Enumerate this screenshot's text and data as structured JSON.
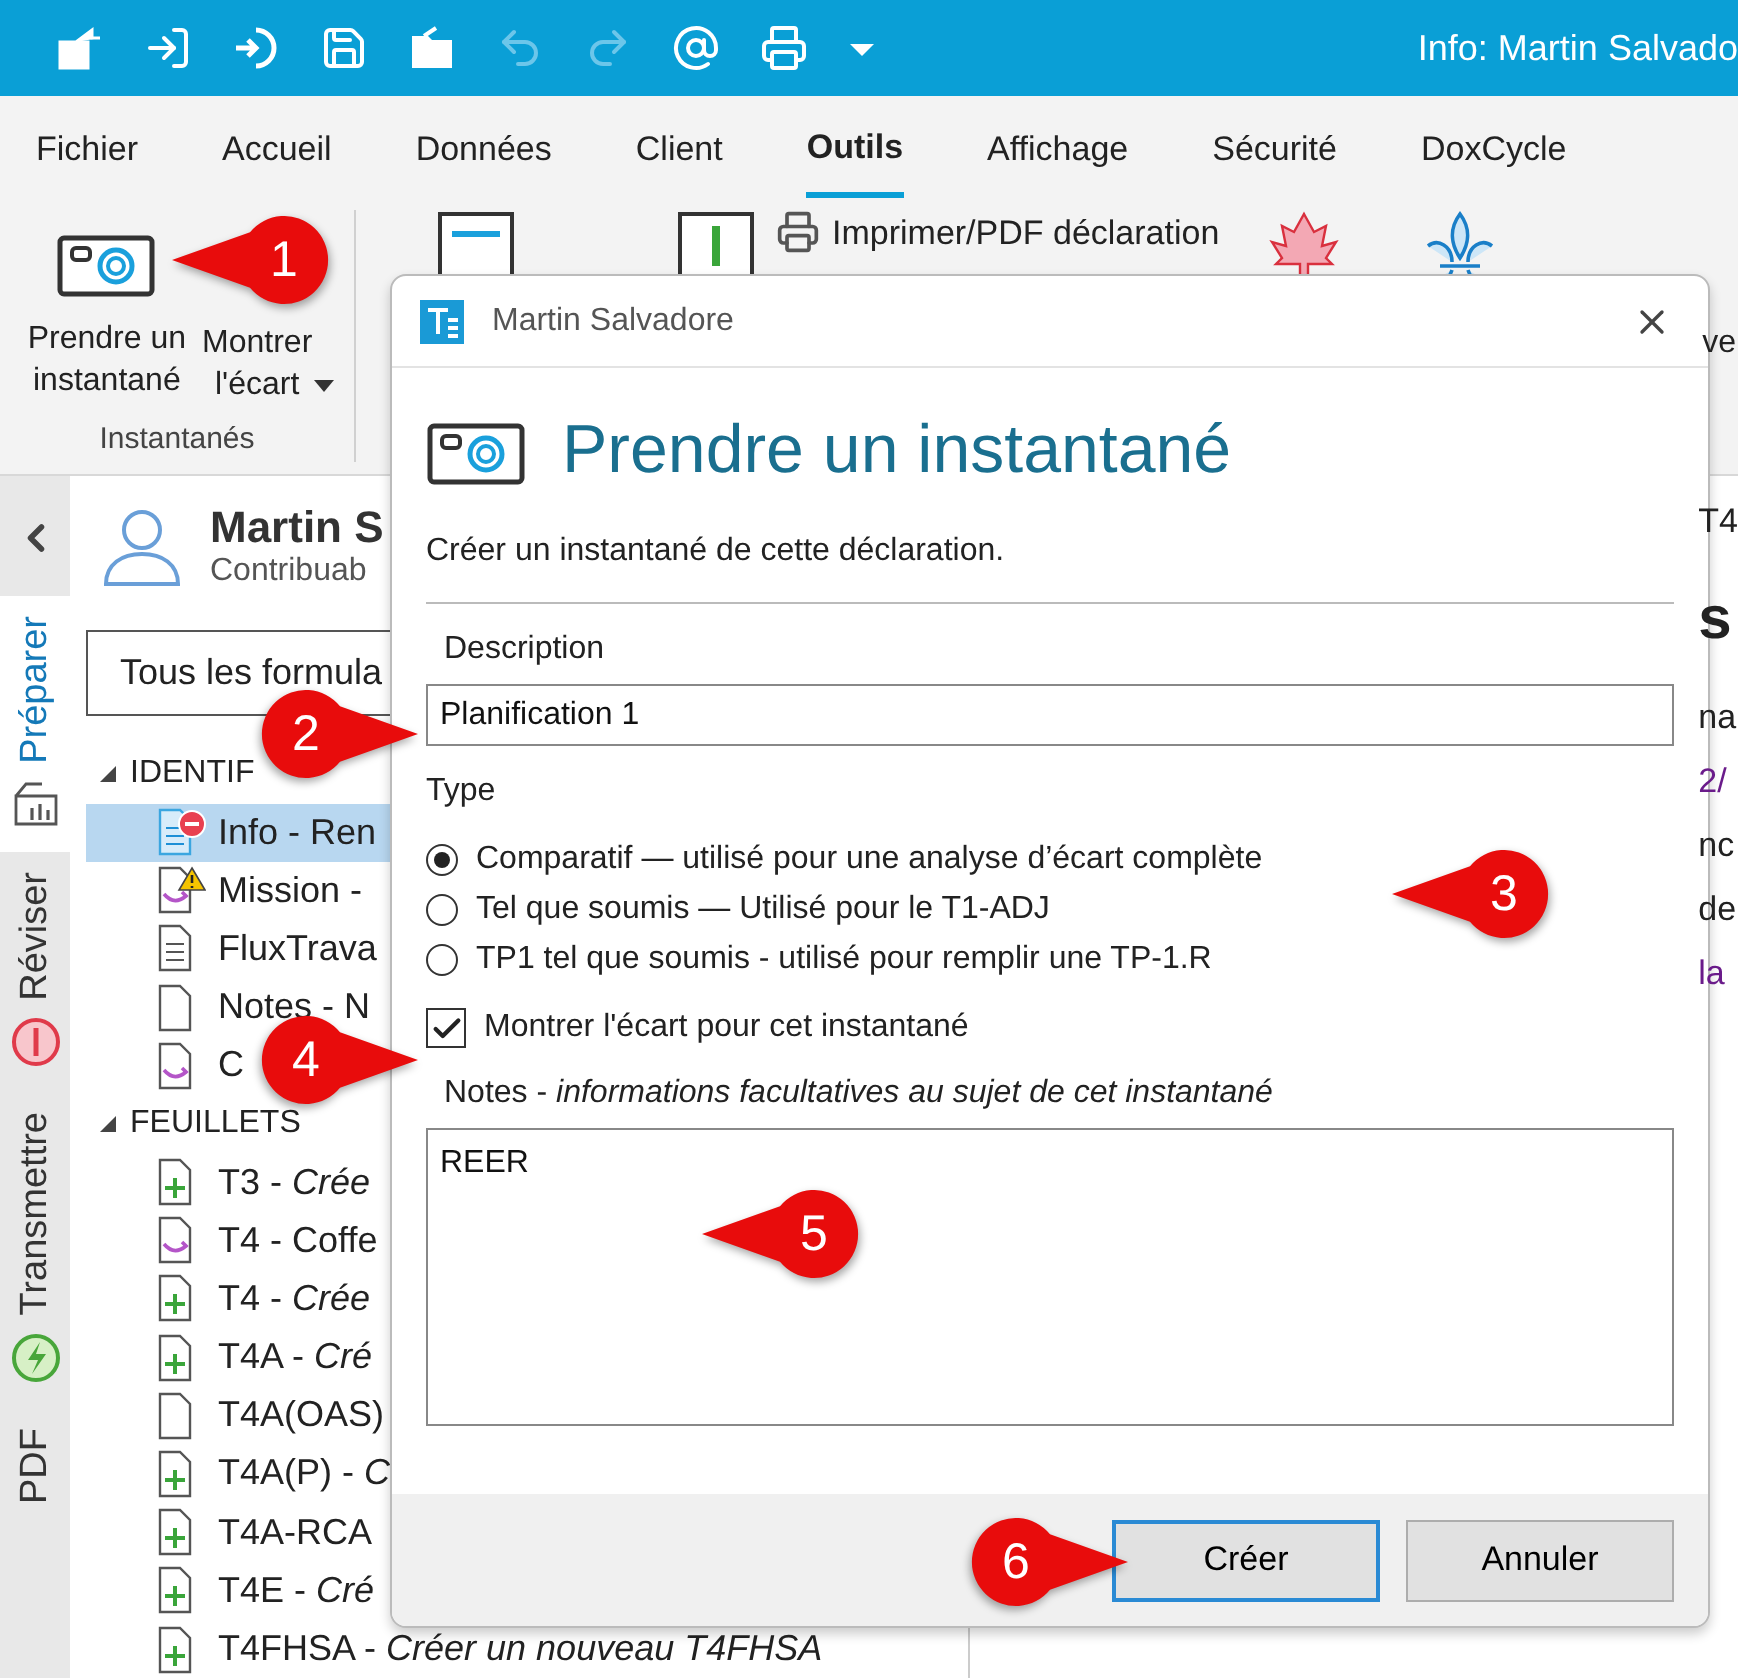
{
  "window": {
    "title": "Info: Martin Salvado"
  },
  "quick_access": [
    {
      "kind": "export",
      "disabled": false
    },
    {
      "kind": "import",
      "disabled": false
    },
    {
      "kind": "restore",
      "disabled": false
    },
    {
      "kind": "save",
      "disabled": false
    },
    {
      "kind": "open",
      "disabled": false
    },
    {
      "kind": "undo",
      "disabled": true
    },
    {
      "kind": "redo",
      "disabled": true
    },
    {
      "kind": "at",
      "disabled": false
    },
    {
      "kind": "print",
      "disabled": false
    },
    {
      "kind": "more",
      "disabled": false
    }
  ],
  "menu_tabs": [
    {
      "label": "Fichier",
      "selected": false
    },
    {
      "label": "Accueil",
      "selected": false
    },
    {
      "label": "Données",
      "selected": false
    },
    {
      "label": "Client",
      "selected": false
    },
    {
      "label": "Outils",
      "selected": true
    },
    {
      "label": "Affichage",
      "selected": false
    },
    {
      "label": "Sécurité",
      "selected": false
    },
    {
      "label": "DoxCycle",
      "selected": false
    }
  ],
  "ribbon": {
    "snapshot_button": "Prendre un\ninstantané",
    "show_gap_button": "Montrer\nl'écart",
    "group_label": "Instantanés",
    "print_button": "Imprimer/PDF déclaration",
    "cut_label": "ve"
  },
  "side_rail": [
    {
      "label": "Préparer",
      "selected": true,
      "kind": "chart"
    },
    {
      "label": "Réviser",
      "selected": false,
      "kind": "alert"
    },
    {
      "label": "Transmettre",
      "selected": false,
      "kind": "bolt"
    },
    {
      "label": "PDF",
      "selected": false,
      "kind": "plain"
    }
  ],
  "client": {
    "name": "Martin S",
    "role": "Contribuab"
  },
  "form_filter": "Tous les formula",
  "tree": [
    {
      "label": "IDENTIF",
      "expanded": true,
      "children": [
        {
          "label": "Info - Ren",
          "kind": "info-error",
          "selected": true
        },
        {
          "label": "Mission -",
          "kind": "arrow-warning",
          "selected": false
        },
        {
          "label": "FluxTrava",
          "kind": "lines",
          "selected": false
        },
        {
          "label": "Notes - N",
          "kind": "blank",
          "selected": false
        },
        {
          "label": "C",
          "kind": "arrow",
          "selected": false
        }
      ]
    },
    {
      "label": "FEUILLETS",
      "expanded": true,
      "children": [
        {
          "label": "T3 - *Crée*",
          "kind": "plus",
          "selected": false
        },
        {
          "label": "T4 - Coffe",
          "kind": "arrow",
          "selected": false
        },
        {
          "label": "T4 - *Crée*",
          "kind": "plus",
          "selected": false
        },
        {
          "label": "T4A - *Cré*",
          "kind": "plus",
          "selected": false
        },
        {
          "label": "T4A(OAS)",
          "kind": "blank",
          "selected": false
        },
        {
          "label": "T4A(P) - *C*",
          "kind": "plus",
          "selected": false
        },
        {
          "label": "T4A-RCA",
          "kind": "plus",
          "selected": false
        },
        {
          "label": "T4E - *Cré*",
          "kind": "plus",
          "selected": false
        },
        {
          "label": "T4FHSA - *Créer un nouveau T4FHSA*",
          "kind": "plus",
          "selected": false
        }
      ]
    }
  ],
  "form_fragments": [
    {
      "text": "T4",
      "kind": "plain"
    },
    {
      "text": "s",
      "kind": "heading"
    },
    {
      "text": "na",
      "kind": "plain"
    },
    {
      "text": "2/",
      "kind": "link"
    },
    {
      "text": "nc",
      "kind": "plain"
    },
    {
      "text": "de",
      "kind": "plain"
    },
    {
      "text": "la",
      "kind": "link"
    }
  ],
  "dialog": {
    "title": "Martin Salvadore",
    "heading": "Prendre un instantané",
    "subtitle": "Créer un instantané de cette déclaration.",
    "description_label": "Description",
    "description_value": "Planification 1",
    "type_label": "Type",
    "types": [
      {
        "label": "Comparatif — utilisé pour une analyse d’écart complète",
        "selected": true
      },
      {
        "label": "Tel que soumis — Utilisé pour le T1-ADJ",
        "selected": false
      },
      {
        "label": "TP1 tel que soumis - utilisé pour remplir une TP-1.R",
        "selected": false
      }
    ],
    "show_gap": {
      "label": "Montrer l'écart pour cet instantané",
      "checked": true
    },
    "notes_label": "Notes - *informations facultatives au sujet de cet instantané*",
    "notes_value": "REER",
    "buttons": [
      {
        "label": "Créer",
        "default": true
      },
      {
        "label": "Annuler",
        "default": false
      }
    ]
  },
  "callouts": [
    {
      "number": "1",
      "kind": "left"
    },
    {
      "number": "2",
      "kind": "right"
    },
    {
      "number": "3",
      "kind": "left"
    },
    {
      "number": "4",
      "kind": "right"
    },
    {
      "number": "5",
      "kind": "left"
    },
    {
      "number": "6",
      "kind": "right"
    }
  ]
}
